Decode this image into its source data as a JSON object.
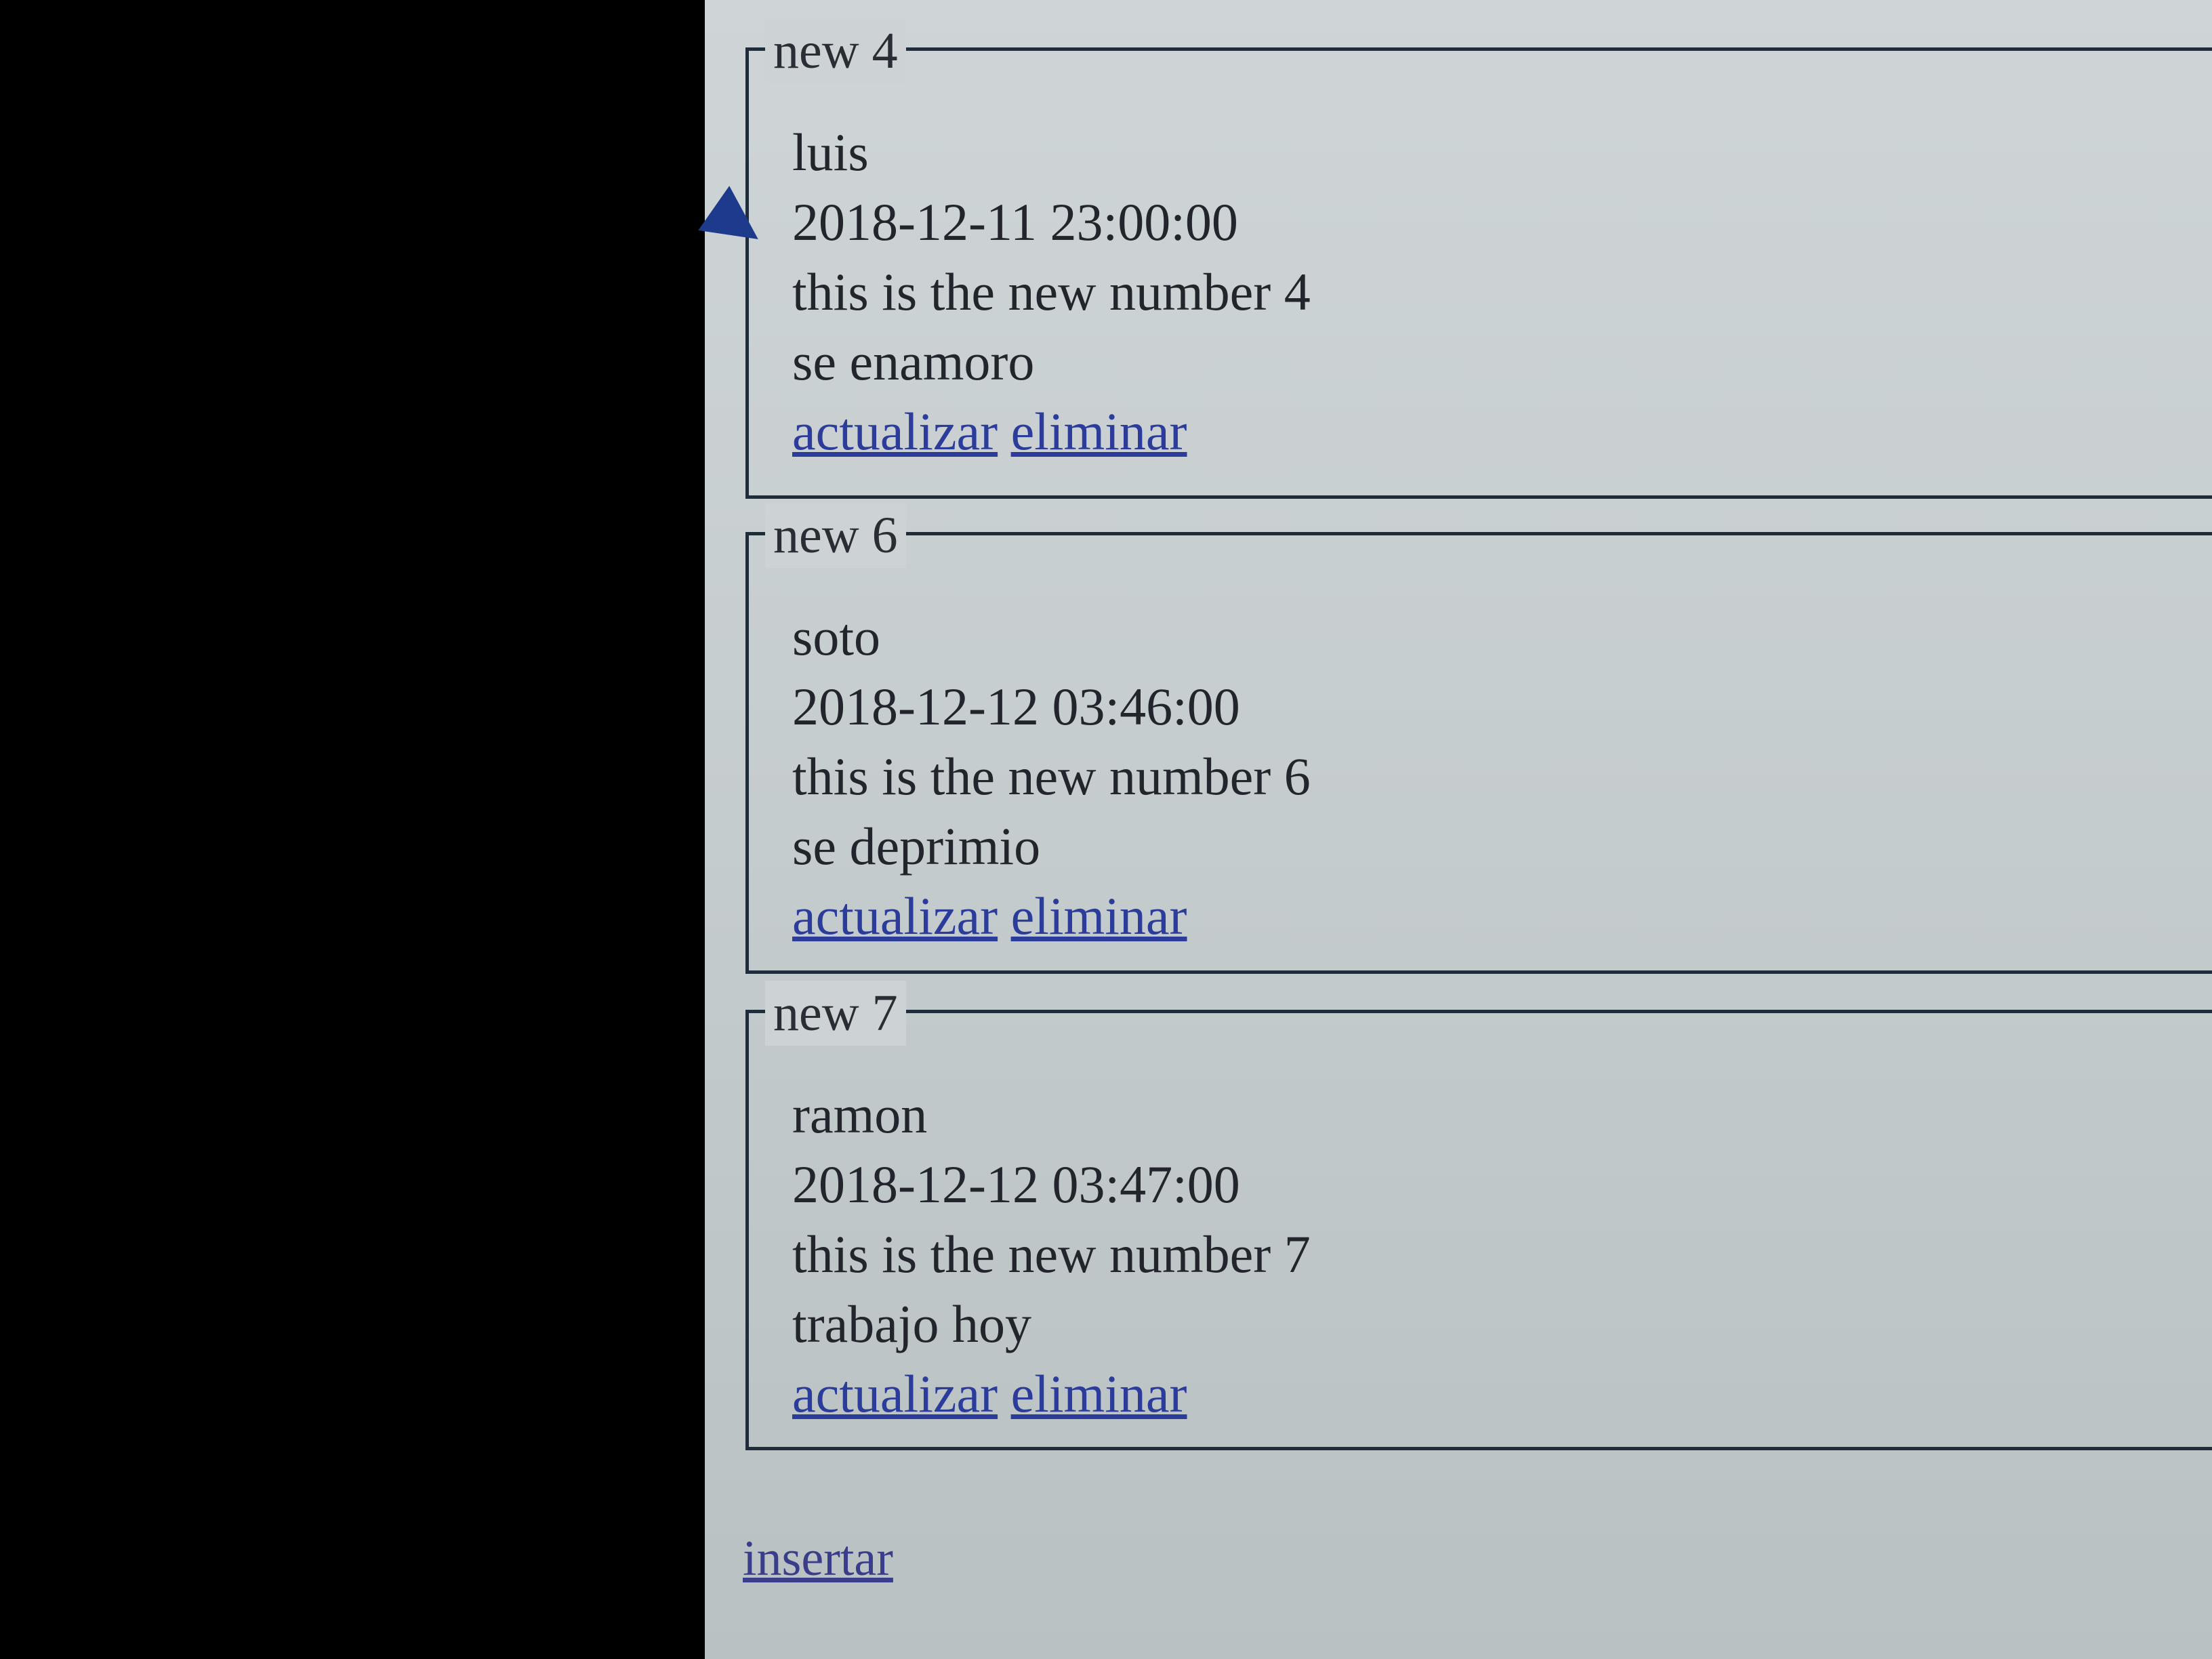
{
  "news": [
    {
      "legend": "new 4",
      "author": "luis",
      "datetime": "2018-12-11 23:00:00",
      "text": "this is the new number 4",
      "description": "se enamoro",
      "update_label": "actualizar",
      "delete_label": "eliminar"
    },
    {
      "legend": "new 6",
      "author": "soto",
      "datetime": "2018-12-12 03:46:00",
      "text": "this is the new number 6",
      "description": "se deprimio",
      "update_label": "actualizar",
      "delete_label": "eliminar"
    },
    {
      "legend": "new 7",
      "author": "ramon",
      "datetime": "2018-12-12 03:47:00",
      "text": "this is the new number 7",
      "description": "trabajo hoy",
      "update_label": "actualizar",
      "delete_label": "eliminar"
    }
  ],
  "insert_label": "insertar",
  "colors": {
    "link": "#2b3c9a",
    "page_background": "#c6cdcf",
    "border": "#1f2d3a"
  }
}
